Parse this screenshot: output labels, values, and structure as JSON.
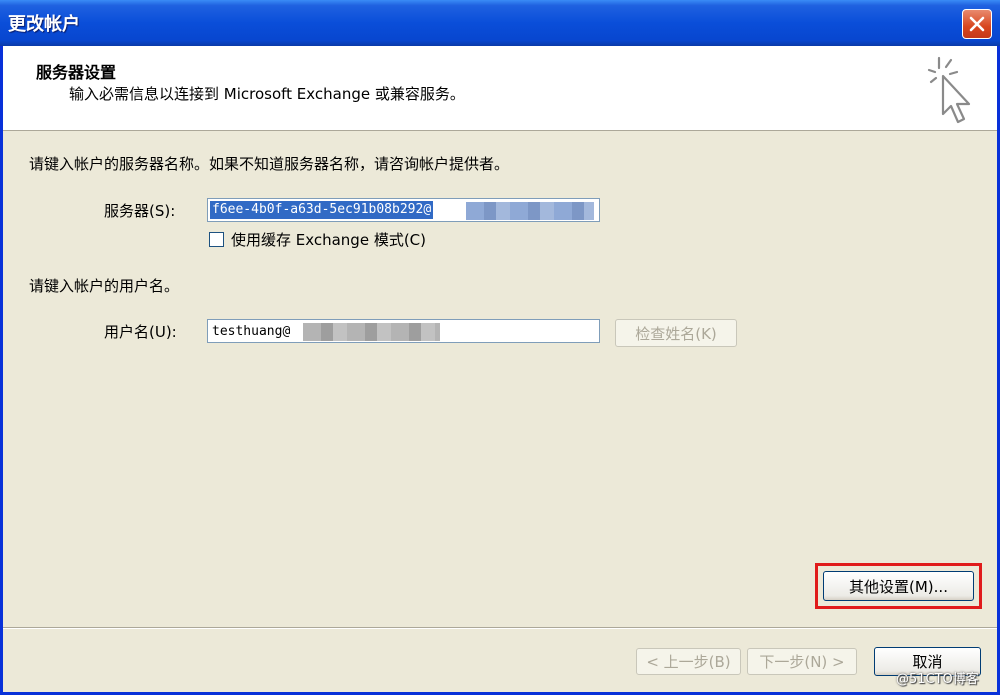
{
  "window": {
    "title": "更改帐户",
    "close_icon": "close-x-icon"
  },
  "header": {
    "title": "服务器设置",
    "subtitle": "输入必需信息以连接到 Microsoft Exchange 或兼容服务。",
    "icon": "cursor-sparkle-icon"
  },
  "server_section": {
    "instruction": "请键入帐户的服务器名称。如果不知道服务器名称，请咨询帐户提供者。",
    "server_label": "服务器(S):",
    "server_value": "f6ee-4b0f-a63d-5ec91b08b292@",
    "cached_mode_label": "使用缓存 Exchange 模式(C)",
    "cached_mode_checked": false
  },
  "user_section": {
    "instruction": "请键入帐户的用户名。",
    "username_label": "用户名(U):",
    "username_value": "testhuang@",
    "check_name_label": "检查姓名(K)"
  },
  "buttons": {
    "more_settings": "其他设置(M)...",
    "back": "< 上一步(B)",
    "next": "下一步(N) >",
    "cancel": "取消"
  },
  "watermark": "@51CTO博客",
  "colors": {
    "title_bar": "#0a4ed9",
    "highlight_box": "#e01b1b",
    "selection": "#316ac5",
    "close_button": "#d8461e"
  }
}
